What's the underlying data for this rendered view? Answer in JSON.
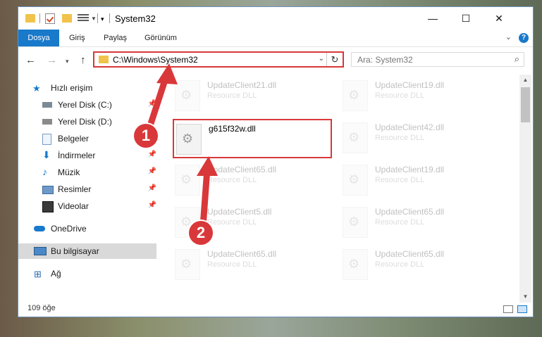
{
  "window": {
    "title": "System32",
    "controls": {
      "minimize": "—",
      "maximize": "☐",
      "close": "✕"
    }
  },
  "ribbon": {
    "tabs": [
      "Dosya",
      "Giriş",
      "Paylaş",
      "Görünüm"
    ],
    "help": "?"
  },
  "address": {
    "path": "C:\\Windows\\System32"
  },
  "search": {
    "placeholder": "Ara: System32"
  },
  "sidebar": {
    "items": [
      {
        "label": "Hızlı erişim",
        "icon": "star-icon"
      },
      {
        "label": "Yerel Disk (C:)",
        "icon": "drive-icon",
        "pinned": true
      },
      {
        "label": "Yerel Disk (D:)",
        "icon": "drive-icon"
      },
      {
        "label": "Belgeler",
        "icon": "documents-icon",
        "pinned": true
      },
      {
        "label": "İndirmeler",
        "icon": "download-icon",
        "pinned": true
      },
      {
        "label": "Müzik",
        "icon": "music-icon",
        "pinned": true
      },
      {
        "label": "Resimler",
        "icon": "pictures-icon",
        "pinned": true
      },
      {
        "label": "Videolar",
        "icon": "video-icon",
        "pinned": true
      },
      {
        "label": "OneDrive",
        "icon": "cloud-icon"
      },
      {
        "label": "Bu bilgisayar",
        "icon": "computer-icon"
      },
      {
        "label": "Ağ",
        "icon": "network-icon"
      }
    ],
    "selected": "Bu bilgisayar"
  },
  "files": {
    "highlighted": {
      "name": "g615f32w.dll",
      "type": ""
    },
    "left": [
      {
        "name": "UpdateClient21.dll",
        "type": "Resource DLL"
      },
      {
        "name": "UpdateClient65.dll",
        "type": "Resource DLL"
      },
      {
        "name": "UpdateClient5.dll",
        "type": "Resource DLL"
      },
      {
        "name": "UpdateClient65.dll",
        "type": "Resource DLL"
      }
    ],
    "right": [
      {
        "name": "UpdateClient19.dll",
        "type": "Resource DLL"
      },
      {
        "name": "UpdateClient42.dll",
        "type": "Resource DLL"
      },
      {
        "name": "UpdateClient19.dll",
        "type": "Resource DLL"
      },
      {
        "name": "UpdateClient65.dll",
        "type": "Resource DLL"
      },
      {
        "name": "UpdateClient65.dll",
        "type": "Resource DLL"
      }
    ]
  },
  "status": {
    "count": "109 öğe"
  },
  "annotations": {
    "step1": "1",
    "step2": "2"
  },
  "colors": {
    "accent": "#1979ca",
    "highlight": "#d9383a"
  }
}
